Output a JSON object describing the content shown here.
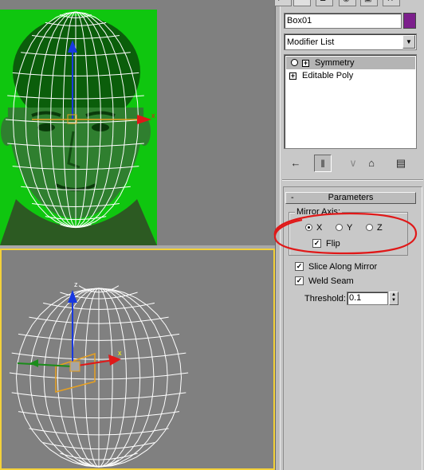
{
  "tabs": [
    {
      "icon": "create-icon",
      "glyph": "▸"
    },
    {
      "icon": "modify-icon",
      "glyph": "≈"
    },
    {
      "icon": "hierarchy-icon",
      "glyph": "≣"
    },
    {
      "icon": "motion-icon",
      "glyph": "◉"
    },
    {
      "icon": "display-icon",
      "glyph": "▣"
    },
    {
      "icon": "utilities-icon",
      "glyph": "⚒"
    }
  ],
  "object": {
    "name": "Box01",
    "color": "#7c1f8c"
  },
  "modifier_list": {
    "label": "Modifier List"
  },
  "stack": [
    {
      "label": "Symmetry",
      "selected": true,
      "expand": "+"
    },
    {
      "label": "Editable Poly",
      "selected": false,
      "expand": "+"
    }
  ],
  "stack_tools": [
    {
      "icon": "pin-stack-icon",
      "glyph": "←"
    },
    {
      "icon": "show-end-result-icon",
      "glyph": "‖"
    },
    {
      "icon": "make-unique-icon",
      "glyph": "∨"
    },
    {
      "icon": "remove-modifier-icon",
      "glyph": "⌂"
    },
    {
      "icon": "configure-modifier-sets-icon",
      "glyph": "▤"
    }
  ],
  "parameters": {
    "title": "Parameters",
    "collapse": "-",
    "mirror_axis": {
      "title": "Mirror Axis:",
      "options": [
        {
          "label": "X",
          "selected": true
        },
        {
          "label": "Y",
          "selected": false
        },
        {
          "label": "Z",
          "selected": false
        }
      ],
      "flip": {
        "label": "Flip",
        "checked": true
      }
    },
    "slice_along_mirror": {
      "label": "Slice Along Mirror",
      "checked": true
    },
    "weld_seam": {
      "label": "Weld Seam",
      "checked": true
    },
    "threshold": {
      "label": "Threshold:",
      "value": "0.1"
    }
  },
  "viewports": {
    "front": {
      "background": "#0fc60f",
      "axis_label": "x"
    },
    "perspective": {
      "border": "#f3d13a",
      "axis_labels": [
        "z",
        "x"
      ]
    }
  },
  "colors": {
    "annotation": "#e01818",
    "gizmo_x": "#e01818",
    "gizmo_y": "#1a8c1a",
    "gizmo_z": "#1838e0",
    "wire": "#ffffff"
  }
}
